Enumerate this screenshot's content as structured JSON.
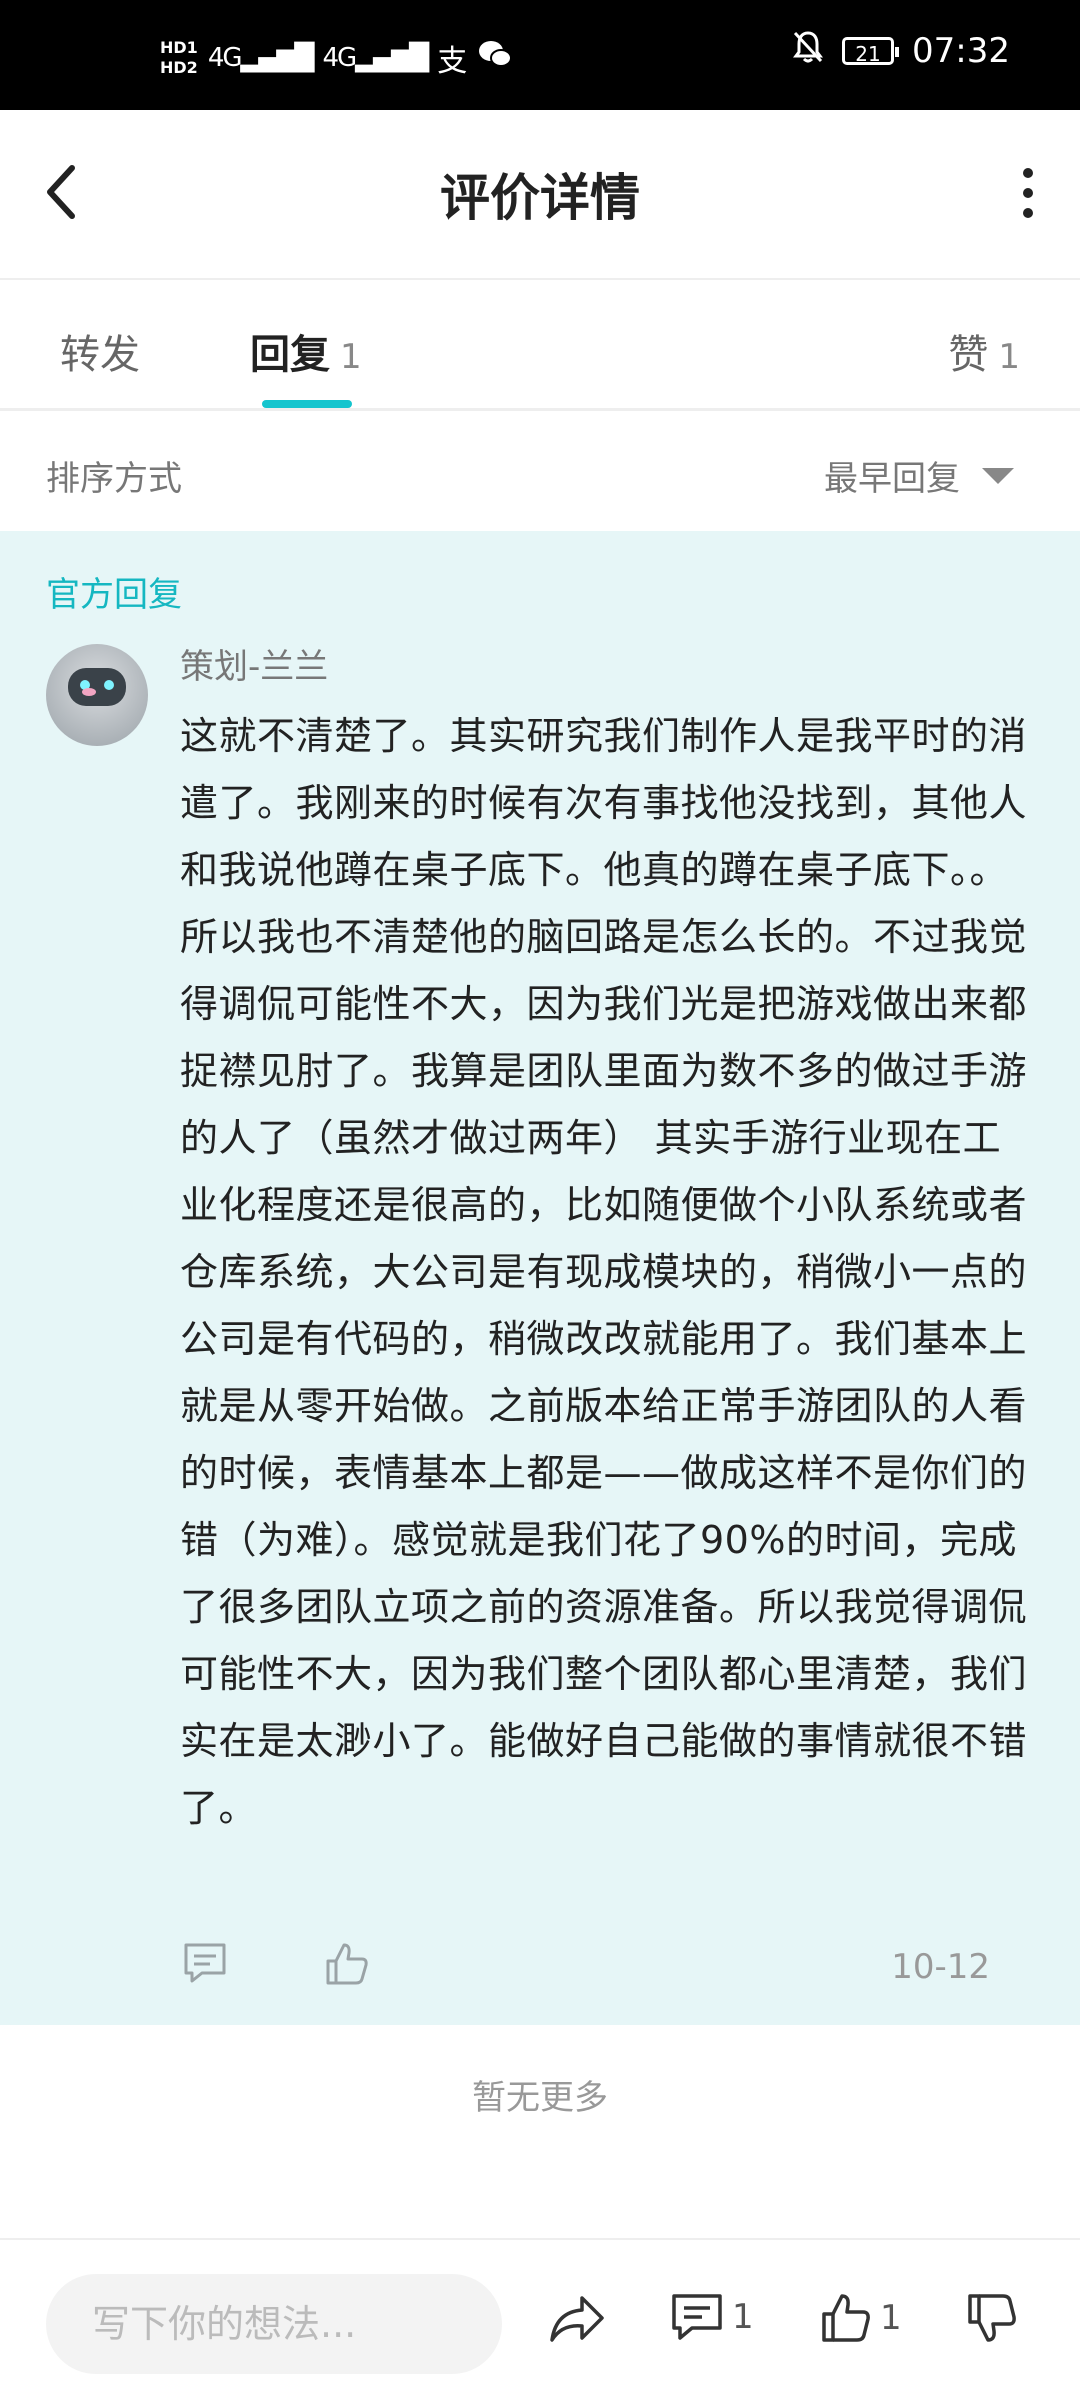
{
  "status_bar": {
    "hd1": "HD1",
    "hd2": "HD2",
    "signal1": "4G",
    "signal2": "4G",
    "battery": "21",
    "time": "07:32"
  },
  "header": {
    "title": "评价详情"
  },
  "tabs": [
    {
      "label": "转发",
      "count": ""
    },
    {
      "label": "回复",
      "count": "1"
    },
    {
      "label": "赞",
      "count": "1"
    }
  ],
  "sort": {
    "label": "排序方式",
    "selected": "最早回复"
  },
  "official_reply": {
    "section_title": "官方回复",
    "author": "策划-兰兰",
    "content": "这就不清楚了。其实研究我们制作人是我平时的消遣了。我刚来的时候有次有事找他没找到，其他人和我说他蹲在桌子底下。他真的蹲在桌子底下。。所以我也不清楚他的脑回路是怎么长的。不过我觉得调侃可能性不大，因为我们光是把游戏做出来都捉襟见肘了。我算是团队里面为数不多的做过手游的人了（虽然才做过两年） 其实手游行业现在工业化程度还是很高的，比如随便做个小队系统或者仓库系统，大公司是有现成模块的，稍微小一点的公司是有代码的，稍微改改就能用了。我们基本上就是从零开始做。之前版本给正常手游团队的人看的时候，表情基本上都是——做成这样不是你们的错（为难）。感觉就是我们花了90%的时间，完成了很多团队立项之前的资源准备。所以我觉得调侃可能性不大，因为我们整个团队都心里清楚，我们实在是太渺小了。能做好自己能做的事情就很不错了。",
    "date": "10-12"
  },
  "no_more": "暂无更多",
  "bottom_bar": {
    "placeholder": "写下你的想法...",
    "comment_count": "1",
    "like_count": "1"
  },
  "colors": {
    "accent": "#15c5ce",
    "official_bg": "#e6f6f7",
    "status_bar": "#000000"
  }
}
